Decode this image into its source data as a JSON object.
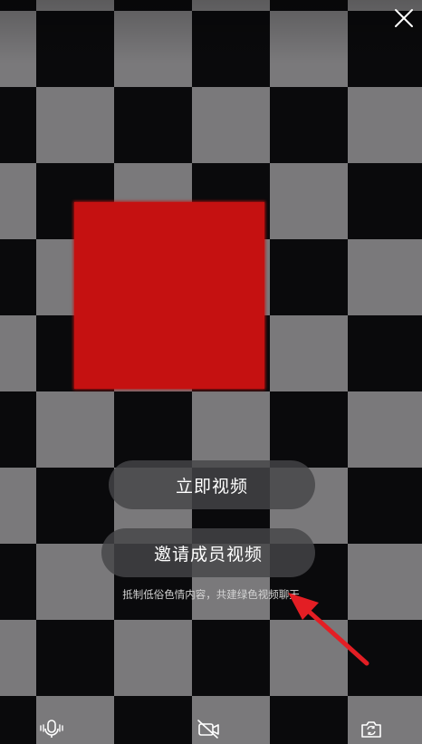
{
  "actions": {
    "start_video_label": "立即视频",
    "invite_members_label": "邀请成员视频"
  },
  "notice": {
    "text": "抵制低俗色情内容，共建绿色视频聊天"
  },
  "icons": {
    "close": "close-icon",
    "microphone": "microphone-icon",
    "camera_off": "camera-off-icon",
    "switch_camera": "switch-camera-icon"
  },
  "colors": {
    "red_block": "#c51111",
    "arrow": "#e31e24",
    "pill_bg": "#464648"
  }
}
